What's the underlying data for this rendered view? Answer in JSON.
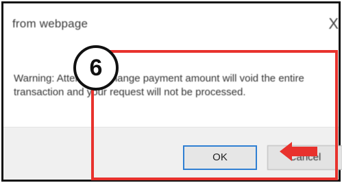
{
  "dialog": {
    "title": "from webpage",
    "close_glyph": "X",
    "message": "Warning: Attempt to change payment amount will void the entire transaction and your request will not be processed.",
    "ok_label": "OK",
    "cancel_label": "Cancel"
  },
  "annotation": {
    "step_number": "6",
    "highlight_color": "#e8322d",
    "arrow_color": "#e8322d",
    "arrow_icon": "left-arrow-icon"
  }
}
